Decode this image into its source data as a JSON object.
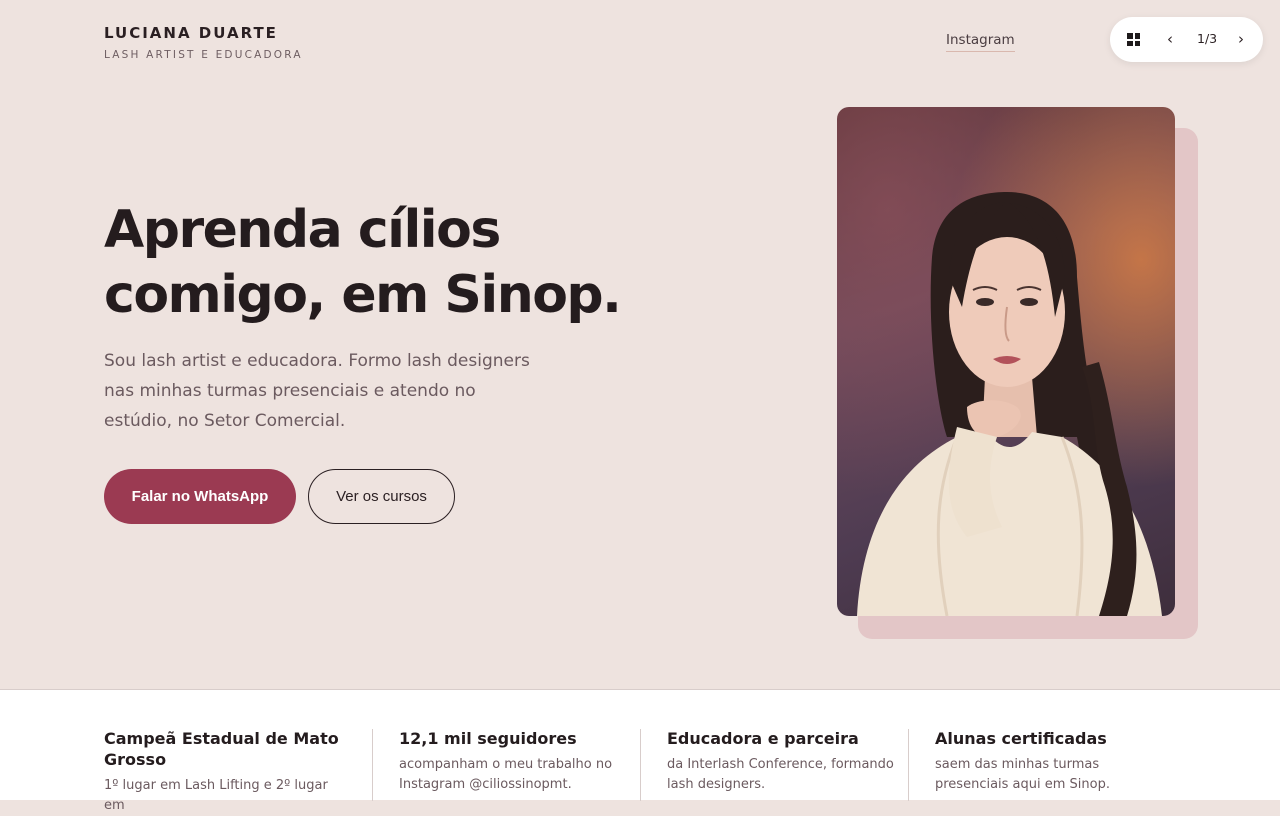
{
  "header": {
    "brand_name": "LUCIANA DUARTE",
    "brand_subtitle": "LASH ARTIST E EDUCADORA",
    "nav_instagram": "Instagram"
  },
  "slide_controls": {
    "grid_icon": "grid-icon",
    "prev": "‹",
    "counter": "1/3",
    "next": "›"
  },
  "hero": {
    "title_line1": "Aprenda cílios",
    "title_line2": "comigo, em Sinop.",
    "description": "Sou lash artist e educadora. Formo lash designers nas minhas turmas presenciais e atendo no estúdio, no Setor Comercial.",
    "primary_button": "Falar no WhatsApp",
    "secondary_button": "Ver os cursos"
  },
  "stats": [
    {
      "title": "Campeã Estadual de Mato Grosso",
      "text": "1º lugar em Lash Lifting e 2º lugar em"
    },
    {
      "title": "12,1 mil seguidores",
      "text": "acompanham o meu trabalho no Instagram @ciliossinopmt."
    },
    {
      "title": "Educadora e parceira",
      "text": "da Interlash Conference, formando lash designers."
    },
    {
      "title": "Alunas certificadas",
      "text": "saem das minhas turmas presenciais aqui em Sinop."
    }
  ],
  "colors": {
    "background": "#EEE3DF",
    "accent": "#9B3A52",
    "text": "#241C1E",
    "muted_text": "#6B5A5F",
    "photo_offset": "#E3C6C7"
  }
}
